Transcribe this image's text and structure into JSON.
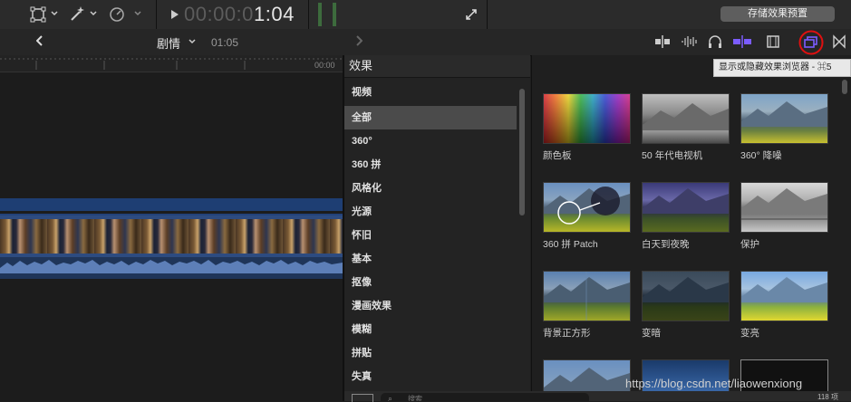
{
  "toolbar": {
    "timecode_dim": "00:00:0",
    "timecode_bright": "1:04",
    "save_preset_label": "存储效果预置"
  },
  "nav": {
    "project_name": "剧情",
    "duration": "01:05"
  },
  "ruler": {
    "time_label": "00:00"
  },
  "effects_browser": {
    "header": "效果",
    "tooltip": "显示或隐藏效果浏览器 - ⌘5",
    "categories": [
      {
        "label": "视频",
        "selected": false
      },
      {
        "label": "全部",
        "selected": true
      },
      {
        "label": "360°",
        "selected": false
      },
      {
        "label": "360 拼",
        "selected": false
      },
      {
        "label": "风格化",
        "selected": false
      },
      {
        "label": "光源",
        "selected": false
      },
      {
        "label": "怀旧",
        "selected": false
      },
      {
        "label": "基本",
        "selected": false
      },
      {
        "label": "抠像",
        "selected": false
      },
      {
        "label": "漫画效果",
        "selected": false
      },
      {
        "label": "模糊",
        "selected": false
      },
      {
        "label": "拼贴",
        "selected": false
      },
      {
        "label": "失真",
        "selected": false
      }
    ],
    "effects": [
      {
        "label": "颜色板",
        "thumb": "rainbow"
      },
      {
        "label": "50 年代电视机",
        "thumb": "bw-mountain"
      },
      {
        "label": "360° 降噪",
        "thumb": "noise-mountain"
      },
      {
        "label": "360 拼 Patch",
        "thumb": "patch-mountain"
      },
      {
        "label": "白天到夜晚",
        "thumb": "night-mountain"
      },
      {
        "label": "保护",
        "thumb": "bw2-mountain"
      },
      {
        "label": "背景正方形",
        "thumb": "square-mountain"
      },
      {
        "label": "变暗",
        "thumb": "dark-mountain"
      },
      {
        "label": "变亮",
        "thumb": "bright-mountain"
      }
    ],
    "search_placeholder": "搜索",
    "count": "118 项"
  },
  "watermark": "https://blog.csdn.net/liaowenxiong",
  "colors": {
    "accent_purple": "#7b5cff",
    "highlight_red": "#e01010"
  }
}
